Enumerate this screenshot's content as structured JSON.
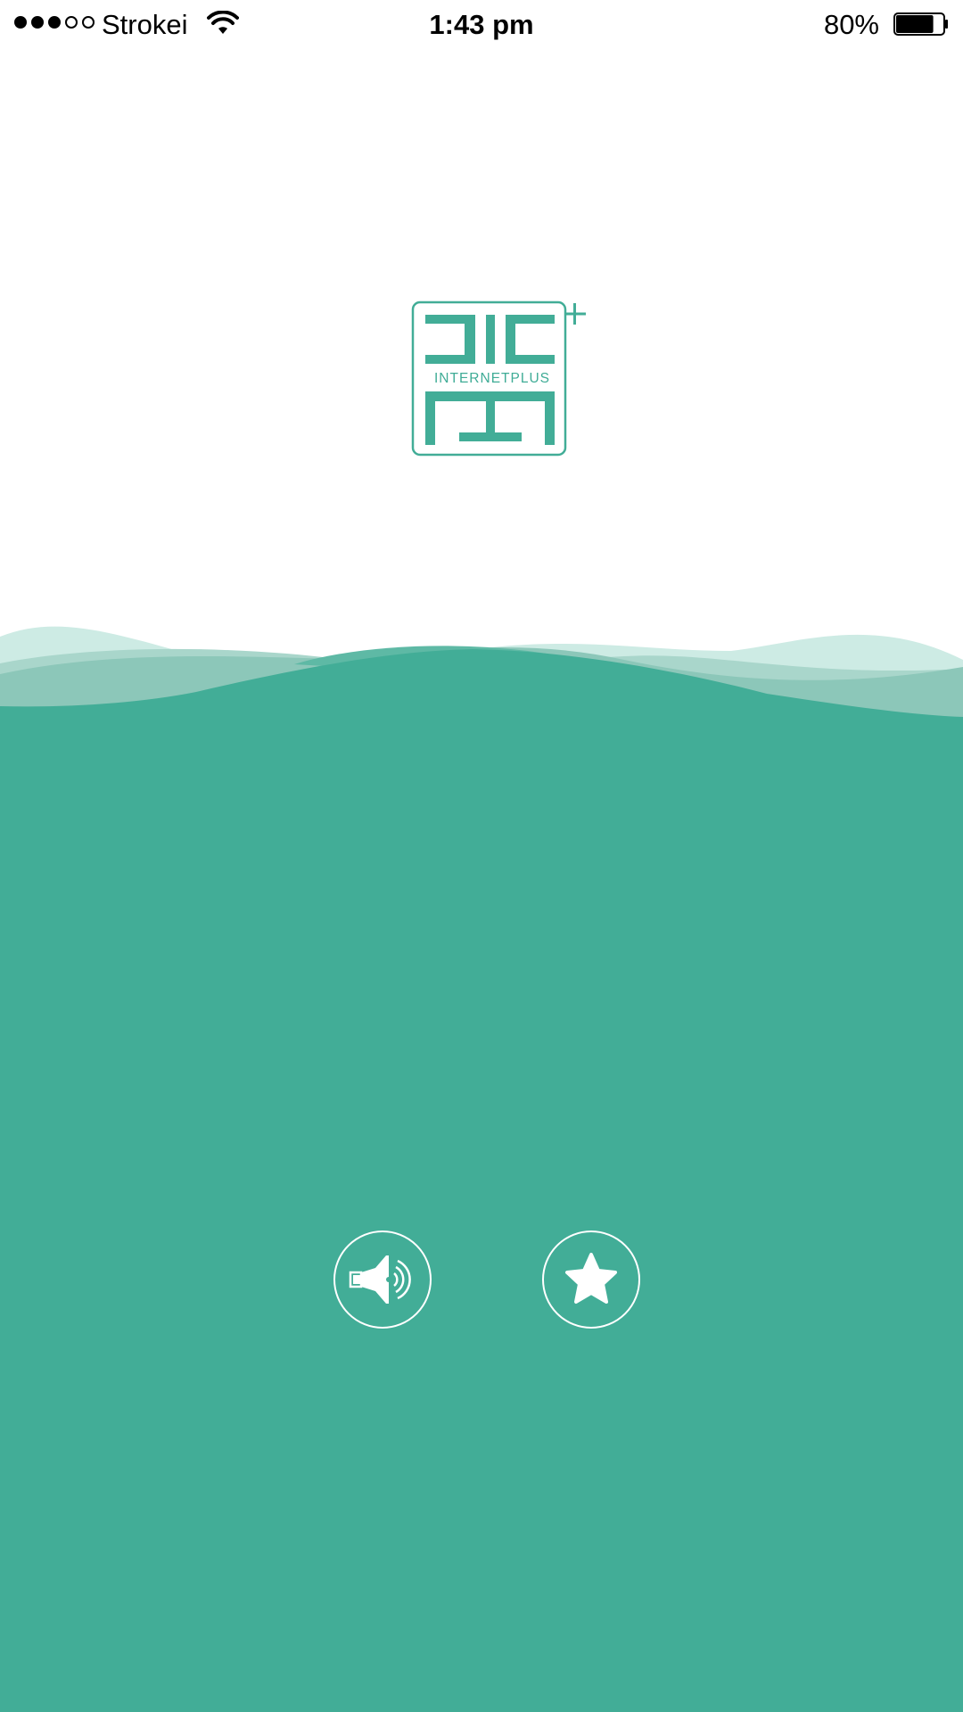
{
  "status_bar": {
    "carrier": "Strokei",
    "time": "1:43 pm",
    "battery_percent": "80%",
    "signal_bars_filled": 3,
    "signal_bars_total": 5,
    "battery_level": 0.8
  },
  "logo": {
    "caption": "INTERNETPLUS",
    "icon": "internetplus-logo"
  },
  "actions": {
    "speaker_icon": "speaker-announce-icon",
    "favorite_icon": "star-icon"
  },
  "colors": {
    "brand": "#42ad97",
    "wave_light": "#cdebe4",
    "wave_mid": "#8cc7b9",
    "background": "#ffffff"
  }
}
